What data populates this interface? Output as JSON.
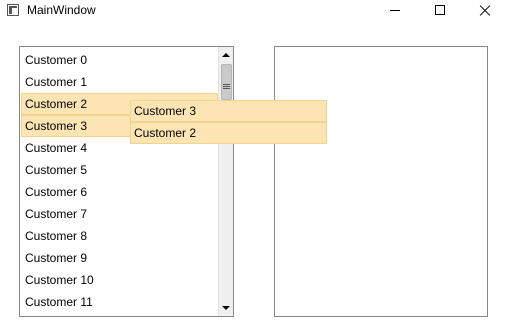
{
  "window": {
    "title": "MainWindow",
    "controls": [
      "minimize",
      "maximize",
      "close"
    ]
  },
  "left_list": {
    "items": [
      {
        "label": "Customer 0",
        "selected": false
      },
      {
        "label": "Customer 1",
        "selected": false
      },
      {
        "label": "Customer 2",
        "selected": true
      },
      {
        "label": "Customer 3",
        "selected": true
      },
      {
        "label": "Customer 4",
        "selected": false
      },
      {
        "label": "Customer 5",
        "selected": false
      },
      {
        "label": "Customer 6",
        "selected": false
      },
      {
        "label": "Customer 7",
        "selected": false
      },
      {
        "label": "Customer 8",
        "selected": false
      },
      {
        "label": "Customer 9",
        "selected": false
      },
      {
        "label": "Customer 10",
        "selected": false
      },
      {
        "label": "Customer 11",
        "selected": false
      }
    ]
  },
  "right_list": {
    "items": []
  },
  "drag_preview": {
    "items": [
      "Customer 3",
      "Customer 2"
    ]
  },
  "colors": {
    "selection_fill": "#fde5b3",
    "selection_border": "#f3d391",
    "listbox_border": "#828790"
  }
}
